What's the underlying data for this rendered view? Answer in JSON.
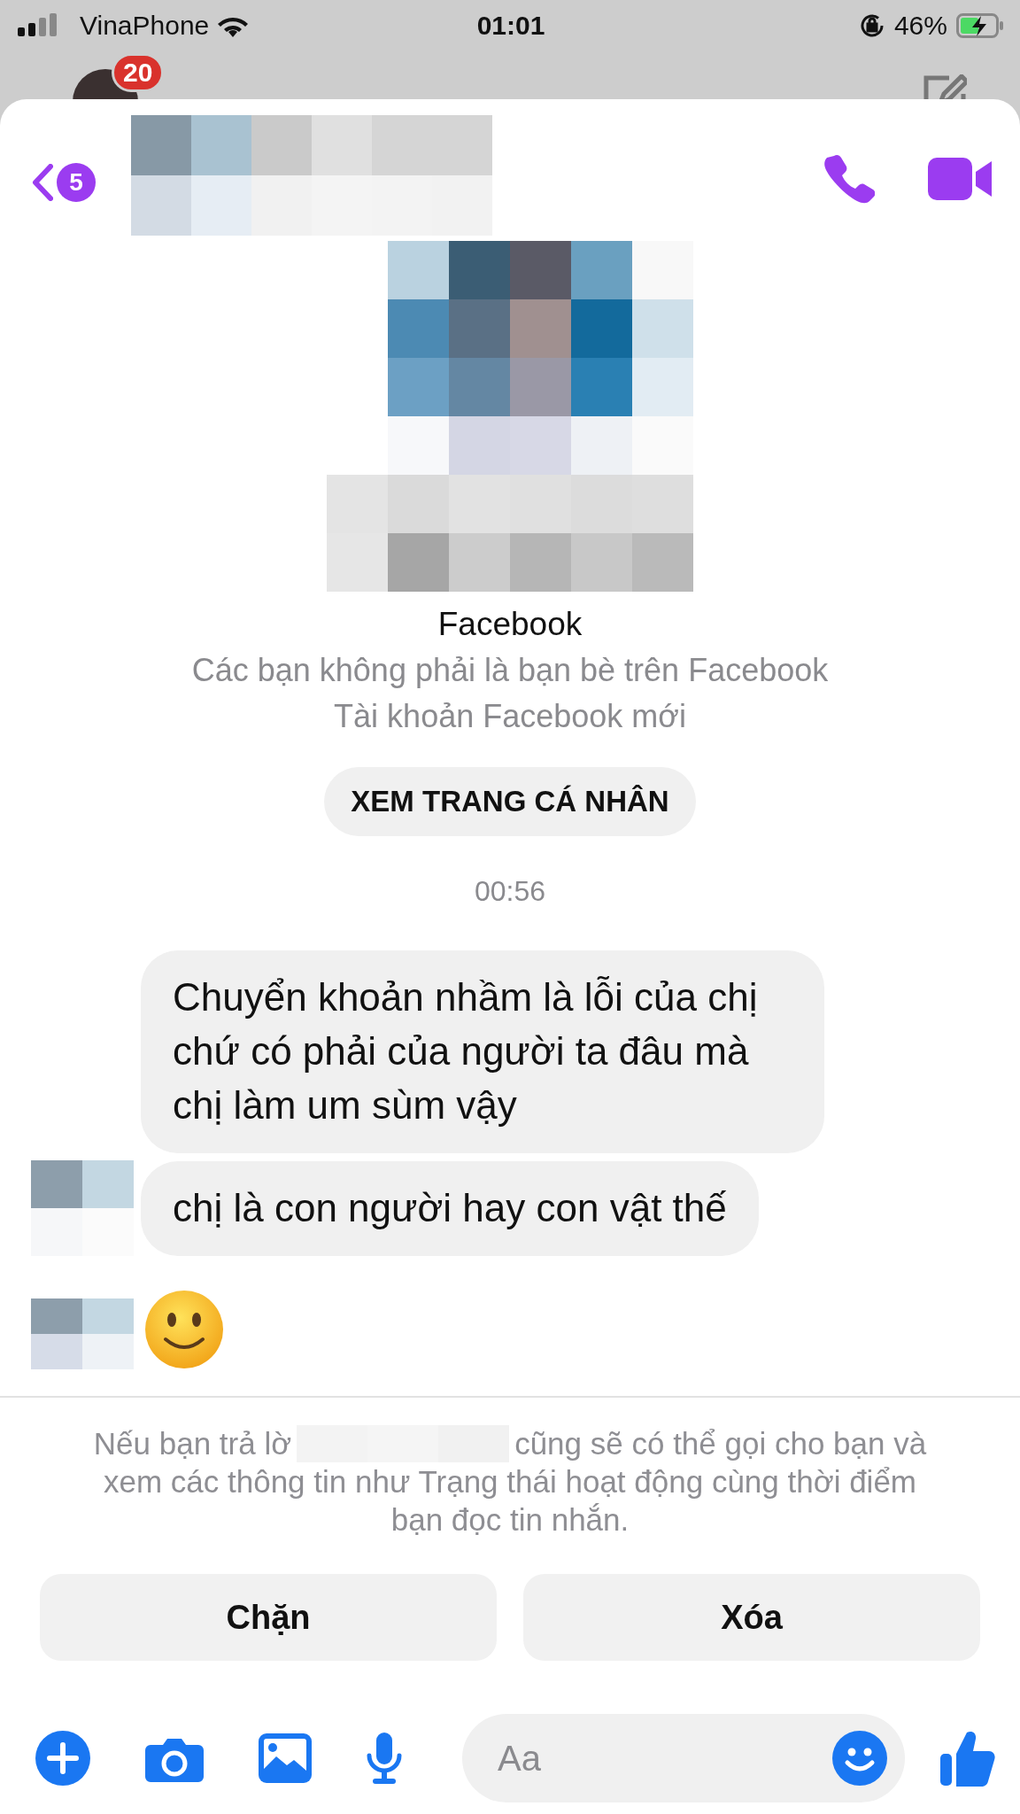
{
  "status_bar": {
    "carrier": "VinaPhone",
    "time": "01:01",
    "battery": "46%"
  },
  "background": {
    "badge": "20"
  },
  "header": {
    "back_count": "5"
  },
  "profile": {
    "name": "Facebook",
    "lines": [
      "Các bạn không phải là bạn bè trên Facebook",
      "Tài khoản Facebook mới"
    ],
    "button": "XEM TRANG CÁ NHÂN"
  },
  "messages": {
    "timestamp": "00:56",
    "items": [
      {
        "kind": "text",
        "text": "Chuyển khoản nhầm là lỗi của chị chứ có phải của người ta đâu mà chị làm um sùm vậy"
      },
      {
        "kind": "text",
        "text": "chị là con người hay con vật thế"
      },
      {
        "kind": "emoji"
      }
    ]
  },
  "request": {
    "notice": [
      "Nếu bạn trả lờ",
      "cũng sẽ có thể gọi cho bạn và",
      "xem các thông tin như Trạng thái hoạt động cùng thời điểm bạn đọc tin nhắn."
    ],
    "actions": [
      "Chặn",
      "Xóa"
    ]
  },
  "composer": {
    "placeholder": "Aa"
  }
}
